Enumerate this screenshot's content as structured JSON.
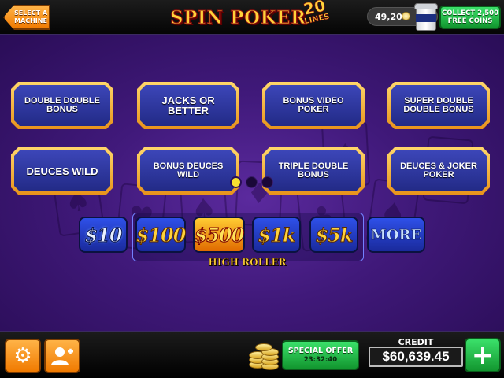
{
  "header": {
    "select_machine_label": "SELECT A MACHINE",
    "logo_main": "SPIN POKER",
    "logo_number": "20",
    "logo_lines": "LINES",
    "coin_balance": "49,204",
    "collect_line1": "COLLECT 2,500",
    "collect_line2": "FREE COINS"
  },
  "games": [
    {
      "label": "DOUBLE DOUBLE BONUS"
    },
    {
      "label": "JACKS OR BETTER"
    },
    {
      "label": "BONUS VIDEO POKER"
    },
    {
      "label": "SUPER DOUBLE DOUBLE BONUS"
    },
    {
      "label": "DEUCES WILD"
    },
    {
      "label": "BONUS DEUCES WILD"
    },
    {
      "label": "TRIPLE DOUBLE BONUS"
    },
    {
      "label": "DEUCES & JOKER POKER"
    }
  ],
  "pagination": {
    "current_page": 1,
    "total_pages": 3
  },
  "denominations": [
    {
      "label": "$10"
    },
    {
      "label": "$100"
    },
    {
      "label": "$500",
      "selected": true
    },
    {
      "label": "$1k"
    },
    {
      "label": "$5k"
    }
  ],
  "more_label": "MORE",
  "high_roller_label": "HIGH ROLLER",
  "footer": {
    "settings_icon": "gear-icon",
    "friends_icon": "add-friend-icon",
    "special_offer_label": "SPECIAL OFFER",
    "special_offer_timer": "23:32:40",
    "credit_label": "CREDIT",
    "credit_value": "$60,639.45",
    "add_label": "+"
  },
  "colors": {
    "accent_orange": "#f07a00",
    "accent_green": "#12962f",
    "button_blue": "#222a86",
    "button_gold_border": "#e8931b",
    "background_purple": "#40197a",
    "page_dot_active": "#f8e030"
  }
}
